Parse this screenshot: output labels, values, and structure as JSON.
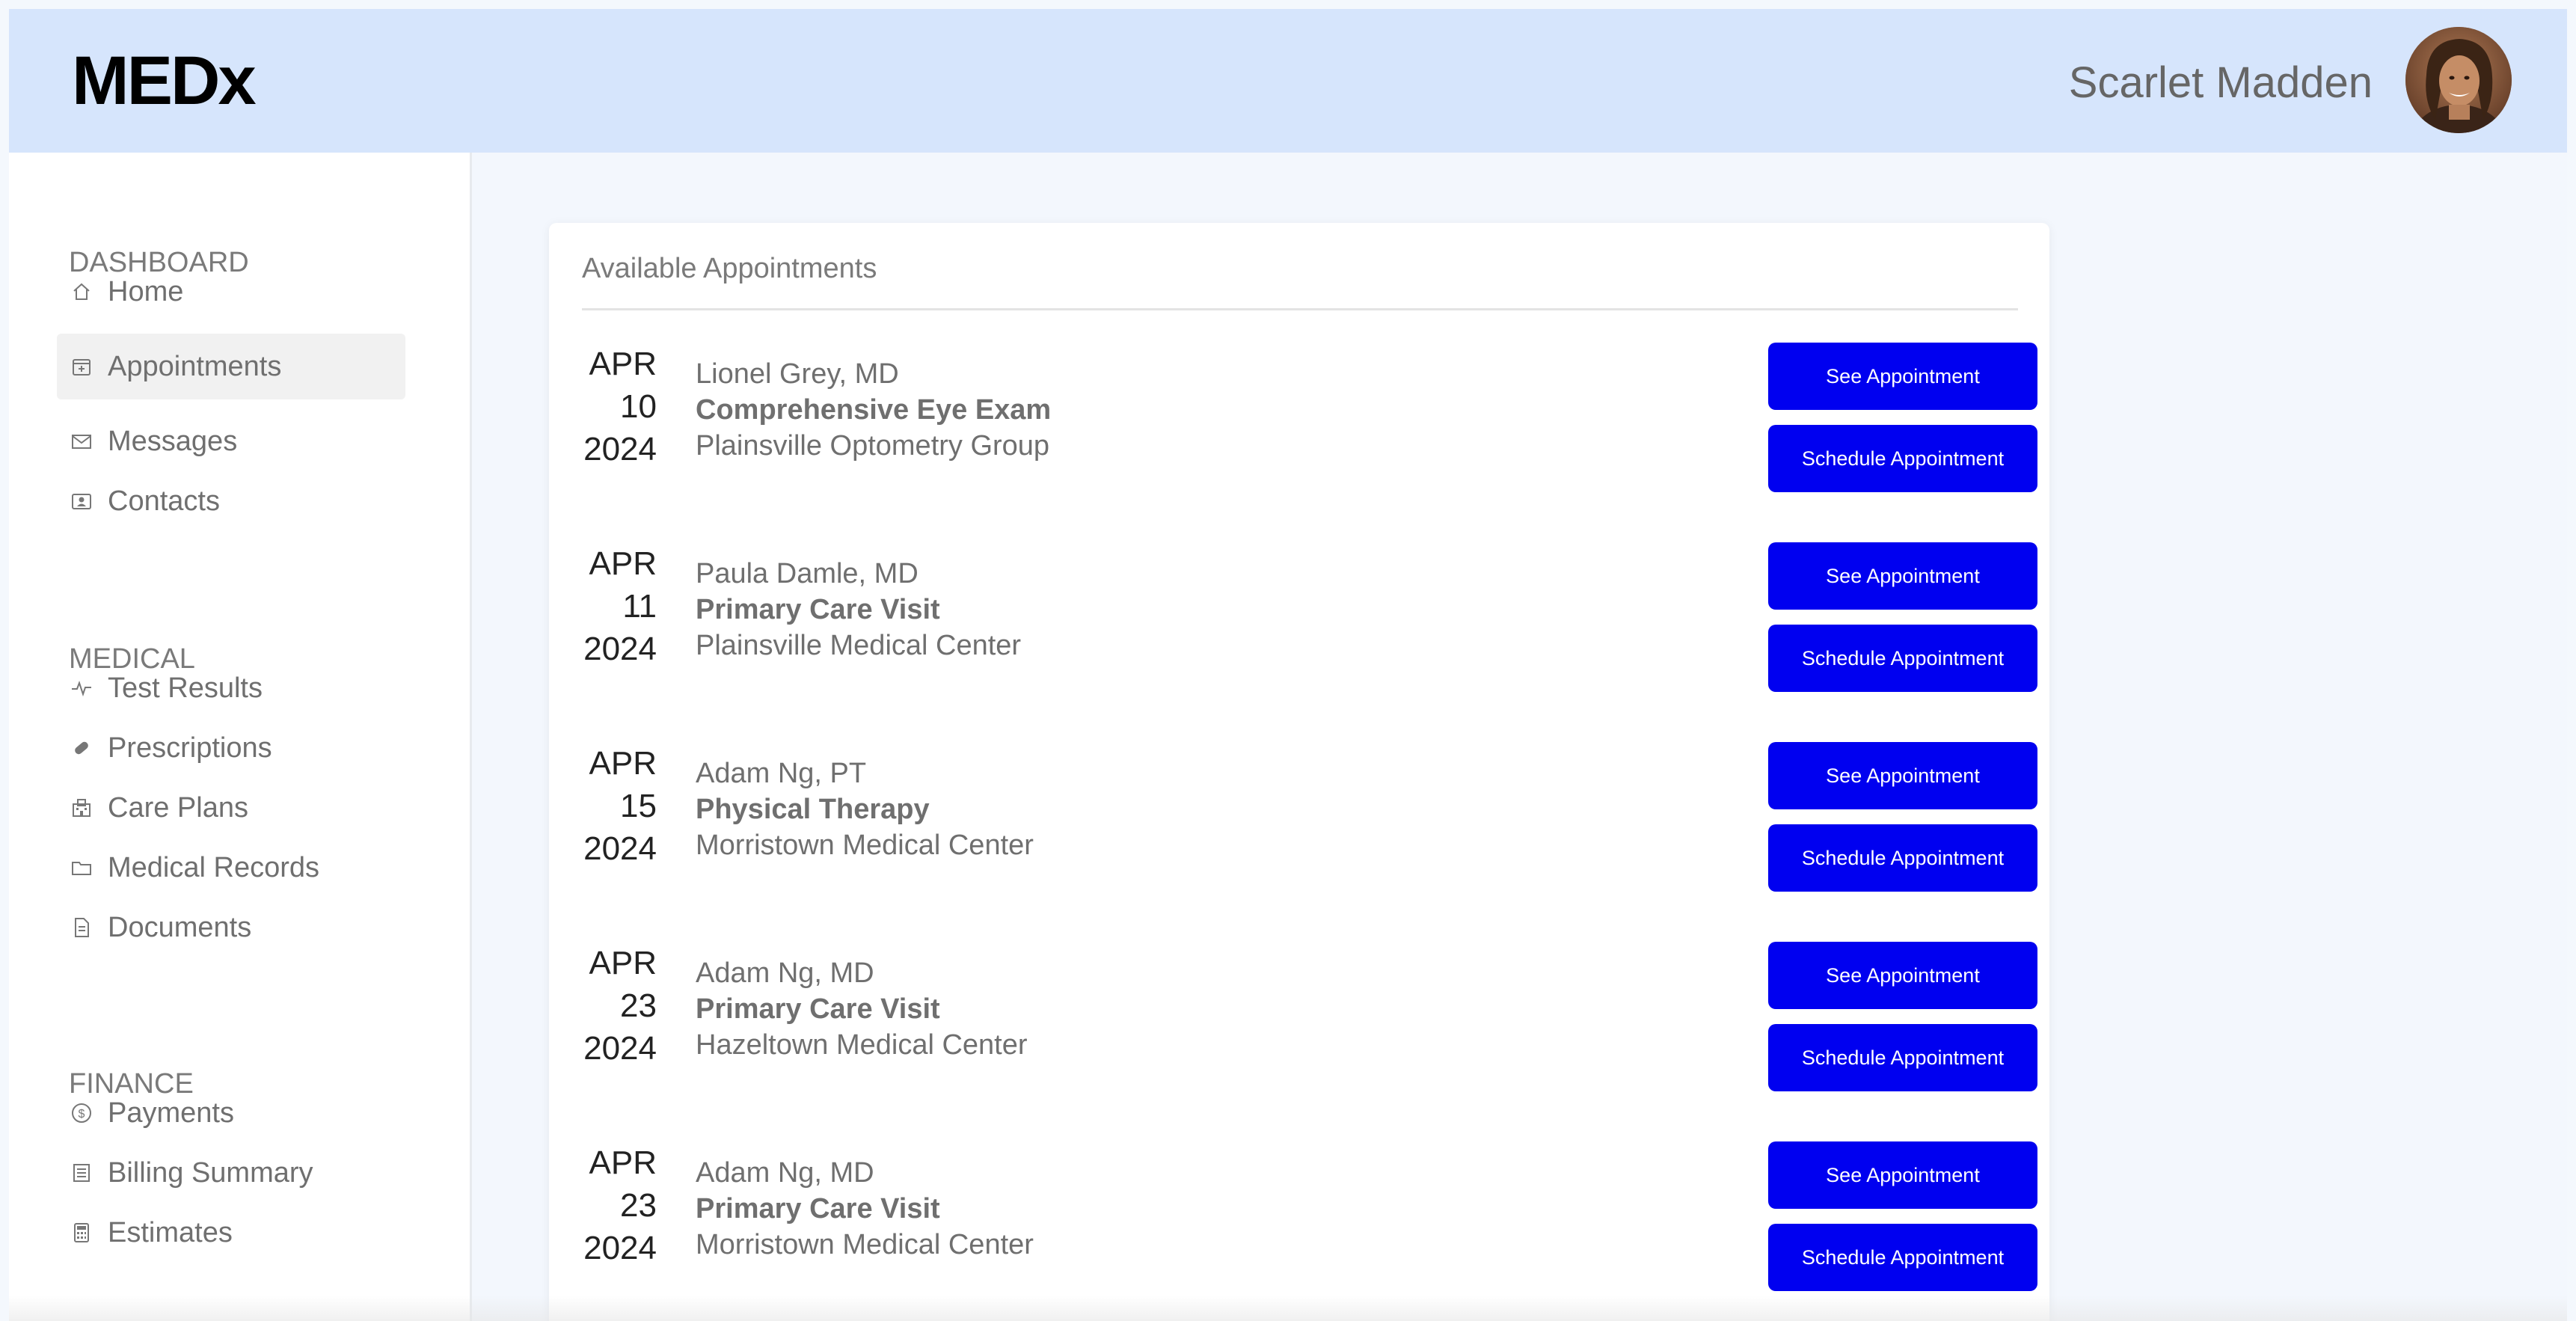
{
  "app": {
    "logo": "MEDx",
    "user_name": "Scarlet Madden"
  },
  "sidebar": {
    "sections": [
      {
        "label": "DASHBOARD",
        "items": [
          {
            "label": "Home",
            "icon": "home-icon"
          },
          {
            "label": "Appointments",
            "icon": "calendar-icon",
            "active": true
          },
          {
            "label": "Messages",
            "icon": "mail-icon"
          },
          {
            "label": "Contacts",
            "icon": "contact-card-icon"
          }
        ]
      },
      {
        "label": "MEDICAL",
        "items": [
          {
            "label": "Test Results",
            "icon": "pulse-icon"
          },
          {
            "label": "Prescriptions",
            "icon": "pill-icon"
          },
          {
            "label": "Care Plans",
            "icon": "hospital-icon"
          },
          {
            "label": "Medical Records",
            "icon": "folder-icon"
          },
          {
            "label": "Documents",
            "icon": "document-icon"
          }
        ]
      },
      {
        "label": "FINANCE",
        "items": [
          {
            "label": "Payments",
            "icon": "dollar-circle-icon"
          },
          {
            "label": "Billing Summary",
            "icon": "receipt-icon"
          },
          {
            "label": "Estimates",
            "icon": "calculator-icon"
          }
        ]
      }
    ]
  },
  "main": {
    "title": "Available Appointments",
    "see_label": "See Appointment",
    "schedule_label": "Schedule Appointment",
    "appointments": [
      {
        "month": "APR",
        "day": "10",
        "year": "2024",
        "doctor": "Lionel Grey, MD",
        "type": "Comprehensive Eye Exam",
        "location": "Plainsville Optometry Group"
      },
      {
        "month": "APR",
        "day": "11",
        "year": "2024",
        "doctor": "Paula Damle, MD",
        "type": "Primary Care Visit",
        "location": "Plainsville Medical Center"
      },
      {
        "month": "APR",
        "day": "15",
        "year": "2024",
        "doctor": "Adam Ng, PT",
        "type": "Physical Therapy",
        "location": "Morristown Medical Center"
      },
      {
        "month": "APR",
        "day": "23",
        "year": "2024",
        "doctor": "Adam Ng, MD",
        "type": "Primary Care Visit",
        "location": "Hazeltown Medical Center"
      },
      {
        "month": "APR",
        "day": "23",
        "year": "2024",
        "doctor": "Adam Ng, MD",
        "type": "Primary Care Visit",
        "location": "Morristown Medical Center"
      }
    ]
  },
  "colors": {
    "header_bg": "#d6e5fc",
    "button_bg": "#0000f0",
    "page_bg": "#f3f7fd"
  }
}
